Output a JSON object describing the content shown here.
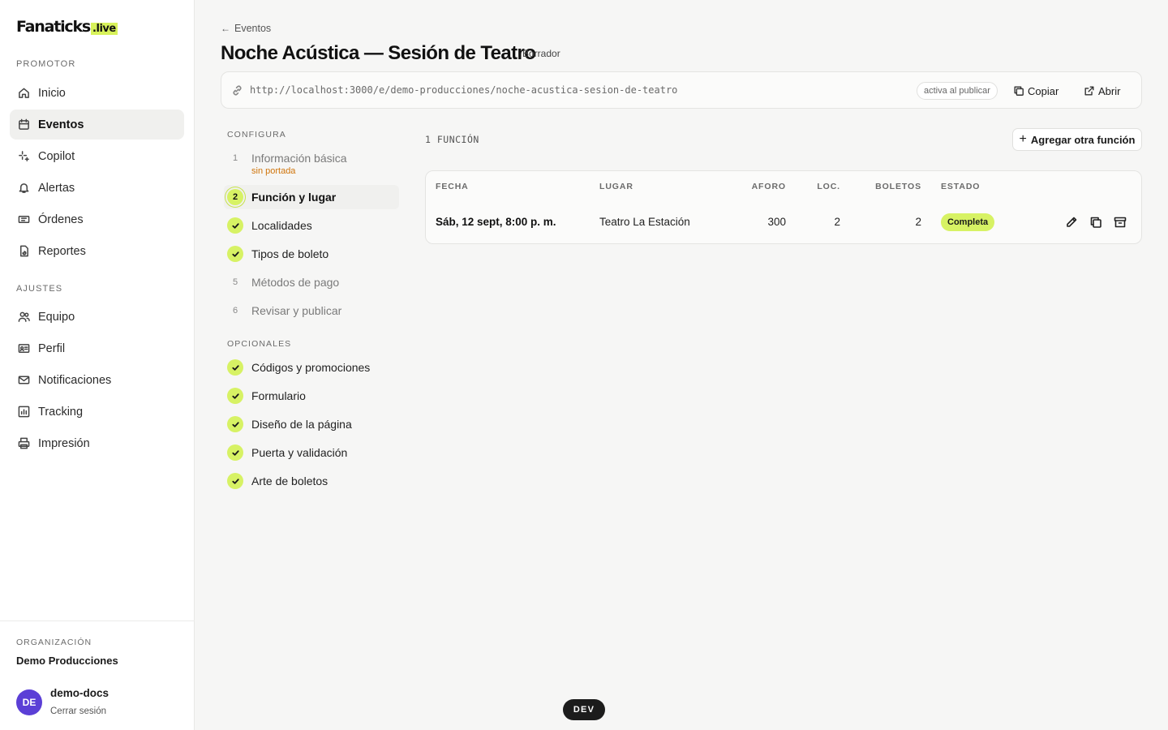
{
  "brand": {
    "logo_main": "Fanaticks",
    "logo_suffix": ".live",
    "accent": "#d7f264"
  },
  "sidebar": {
    "section_promotor": "PROMOTOR",
    "section_ajustes": "AJUSTES",
    "items": [
      {
        "label": "Inicio",
        "icon": "home-icon"
      },
      {
        "label": "Eventos",
        "icon": "calendar-icon",
        "active": true
      },
      {
        "label": "Copilot",
        "icon": "sparkles-icon"
      },
      {
        "label": "Alertas",
        "icon": "bell-icon"
      },
      {
        "label": "Órdenes",
        "icon": "ticket-icon"
      },
      {
        "label": "Reportes",
        "icon": "report-icon"
      }
    ],
    "settings_items": [
      {
        "label": "Equipo",
        "icon": "users-icon"
      },
      {
        "label": "Perfil",
        "icon": "id-card-icon"
      },
      {
        "label": "Notificaciones",
        "icon": "mail-icon"
      },
      {
        "label": "Tracking",
        "icon": "chart-icon"
      },
      {
        "label": "Impresión",
        "icon": "printer-icon"
      }
    ],
    "org_label": "ORGANIZACIÓN",
    "org_name": "Demo Producciones",
    "user": {
      "initials": "DE",
      "name": "demo-docs",
      "logout": "Cerrar sesión",
      "avatar_color": "#5b3fd6"
    }
  },
  "header": {
    "back_label": "Eventos",
    "title": "Noche Acústica — Sesión de Teatro",
    "status": "Borrador"
  },
  "url_bar": {
    "url": "http://localhost:3000/e/demo-producciones/noche-acustica-sesion-de-teatro",
    "status": "activa al publicar",
    "copy_label": "Copiar",
    "open_label": "Abrir"
  },
  "steps": {
    "configura_heading": "CONFIGURA",
    "configura": [
      {
        "number": "1",
        "label": "Información básica",
        "state": "pending",
        "warning": "sin portada"
      },
      {
        "number": "2",
        "label": "Función y lugar",
        "state": "current"
      },
      {
        "number": "",
        "label": "Localidades",
        "state": "done"
      },
      {
        "number": "",
        "label": "Tipos de boleto",
        "state": "done"
      },
      {
        "number": "5",
        "label": "Métodos de pago",
        "state": "pending"
      },
      {
        "number": "6",
        "label": "Revisar y publicar",
        "state": "pending"
      }
    ],
    "opcionales_heading": "OPCIONALES",
    "opcionales": [
      {
        "label": "Códigos y promociones",
        "state": "done"
      },
      {
        "label": "Formulario",
        "state": "done"
      },
      {
        "label": "Diseño de la página",
        "state": "done"
      },
      {
        "label": "Puerta y validación",
        "state": "done"
      },
      {
        "label": "Arte de boletos",
        "state": "done"
      }
    ]
  },
  "functions": {
    "count_label": "1 FUNCIÓN",
    "add_label": "Agregar otra función",
    "columns": [
      "FECHA",
      "LUGAR",
      "AFORO",
      "LOC.",
      "BOLETOS",
      "ESTADO"
    ],
    "rows": [
      {
        "fecha": "Sáb, 12 sept, 8:00 p. m.",
        "lugar": "Teatro La Estación",
        "aforo": "300",
        "loc": "2",
        "boletos": "2",
        "estado": "Completa"
      }
    ]
  },
  "dev_badge": "DEV"
}
